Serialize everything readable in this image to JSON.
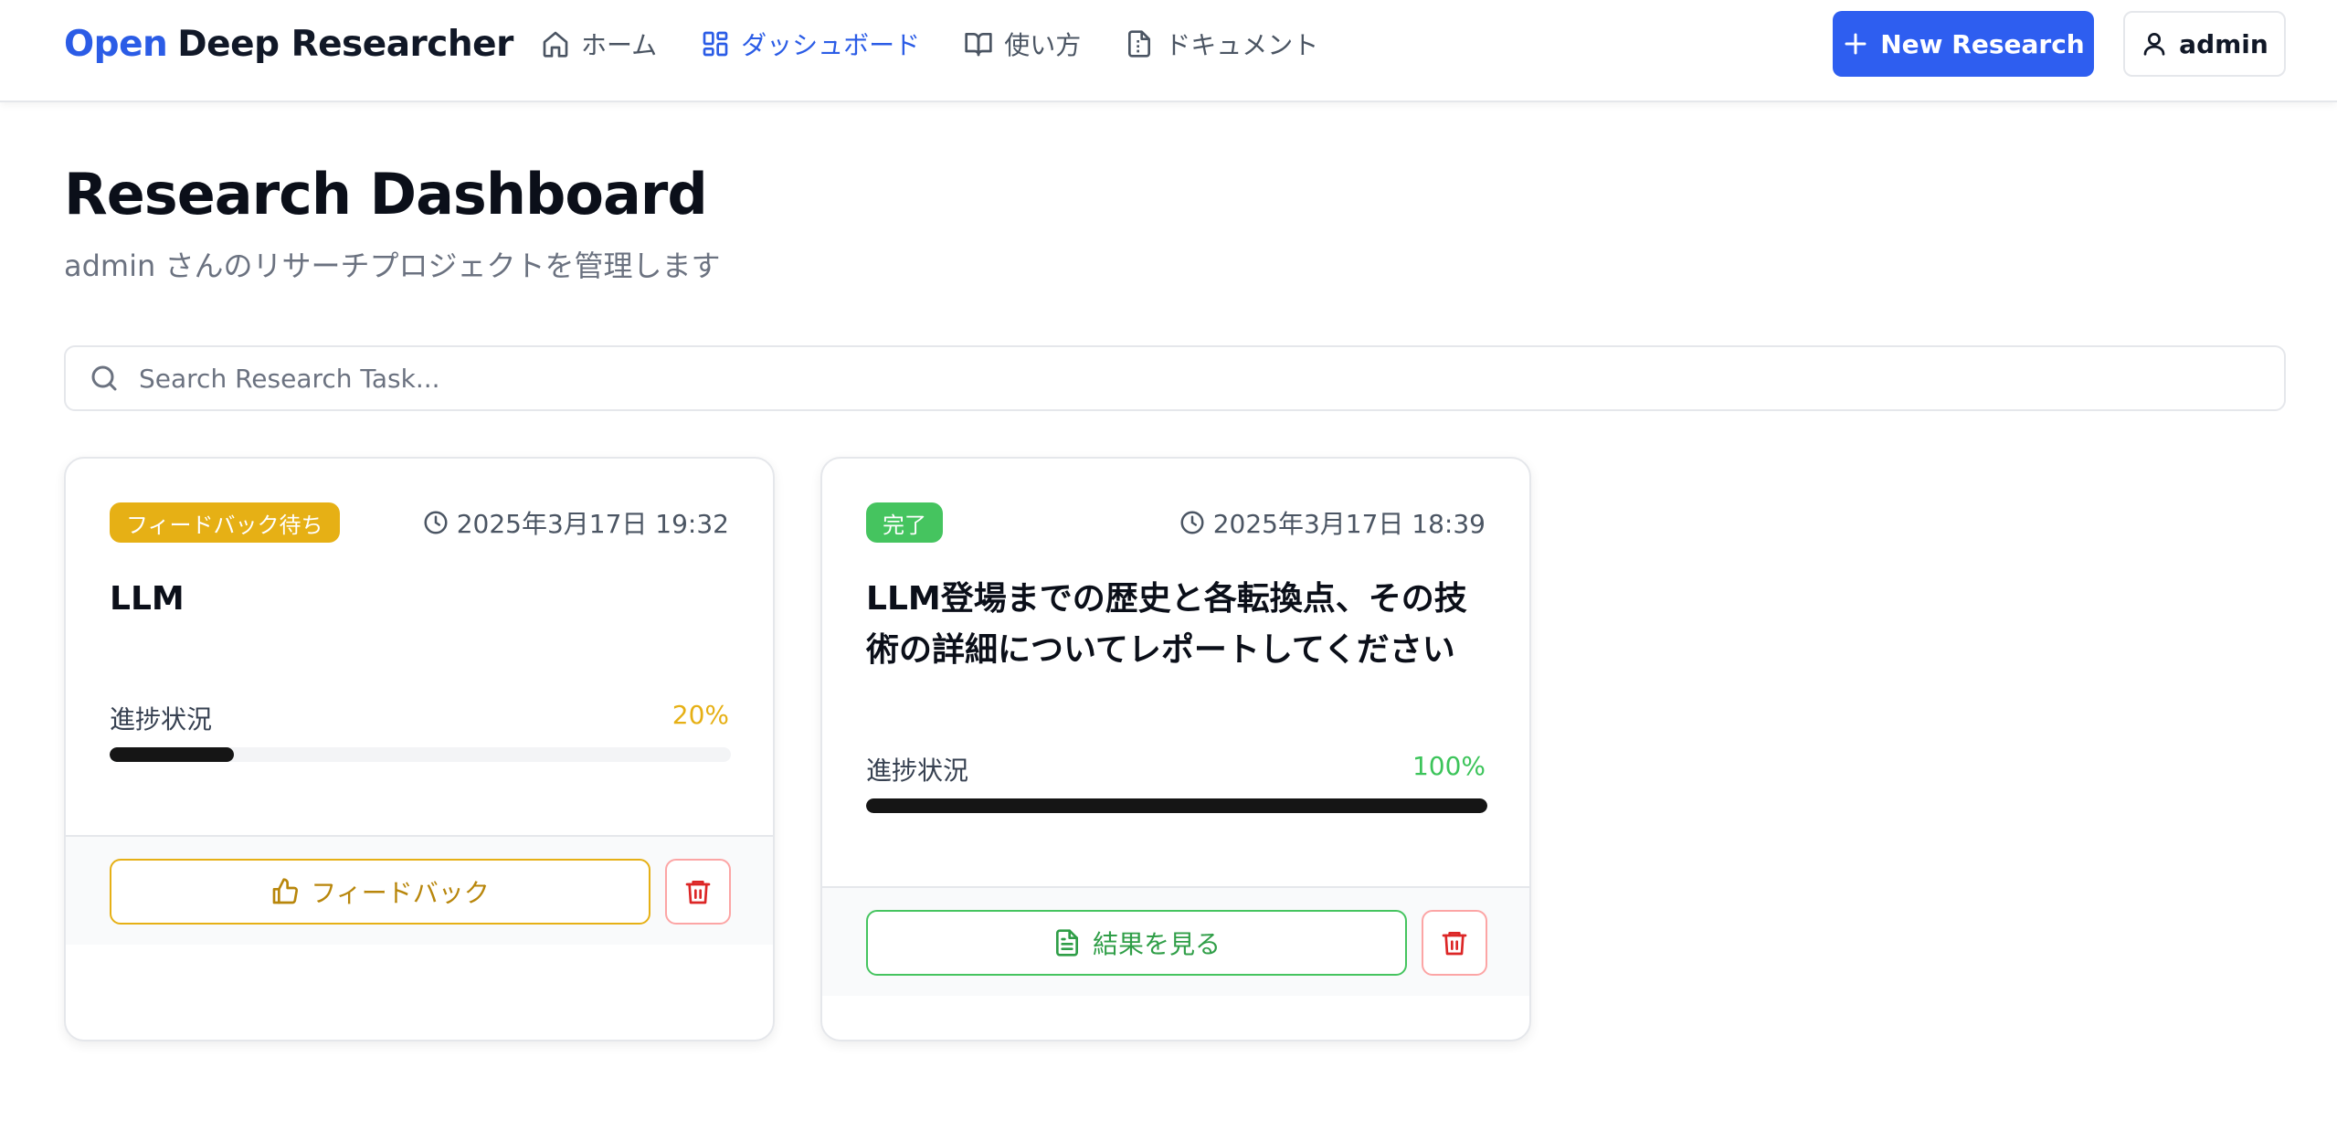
{
  "header": {
    "brand_open": "Open",
    "brand_rest": "Deep Researcher",
    "nav": [
      {
        "label": "ホーム",
        "icon": "home-icon",
        "active": false
      },
      {
        "label": "ダッシュボード",
        "icon": "dashboard-icon",
        "active": true
      },
      {
        "label": "使い方",
        "icon": "book-icon",
        "active": false
      },
      {
        "label": "ドキュメント",
        "icon": "document-icon",
        "active": false
      }
    ],
    "new_research_label": "New Research",
    "user_label": "admin"
  },
  "page": {
    "title": "Research Dashboard",
    "subtitle": "admin さんのリサーチプロジェクトを管理します"
  },
  "search": {
    "placeholder": "Search Research Task...",
    "value": ""
  },
  "cards": [
    {
      "status": "フィードバック待ち",
      "status_color": "#e6b015",
      "date": "2025年3月17日 19:32",
      "title": "LLM",
      "progress_label": "進捗状況",
      "progress_text": "20%",
      "progress": 0.2,
      "progress_color": "#e6b015",
      "action_label": "フィードバック",
      "action_icon": "thumbs-up-icon",
      "action_color": "#e6b015",
      "action_text_color": "#b8860b"
    },
    {
      "status": "完了",
      "status_color": "#45c45f",
      "date": "2025年3月17日 18:39",
      "title": "LLM登場までの歴史と各転換点、その技術の詳細についてレポートしてください",
      "progress_label": "進捗状況",
      "progress_text": "100%",
      "progress": 1.0,
      "progress_color": "#3cc45a",
      "action_label": "結果を見る",
      "action_icon": "file-text-icon",
      "action_color": "#45c45f",
      "action_text_color": "#2f9e47"
    }
  ],
  "colors": {
    "accent": "#2e5ef0",
    "delete": "#dc2626"
  }
}
